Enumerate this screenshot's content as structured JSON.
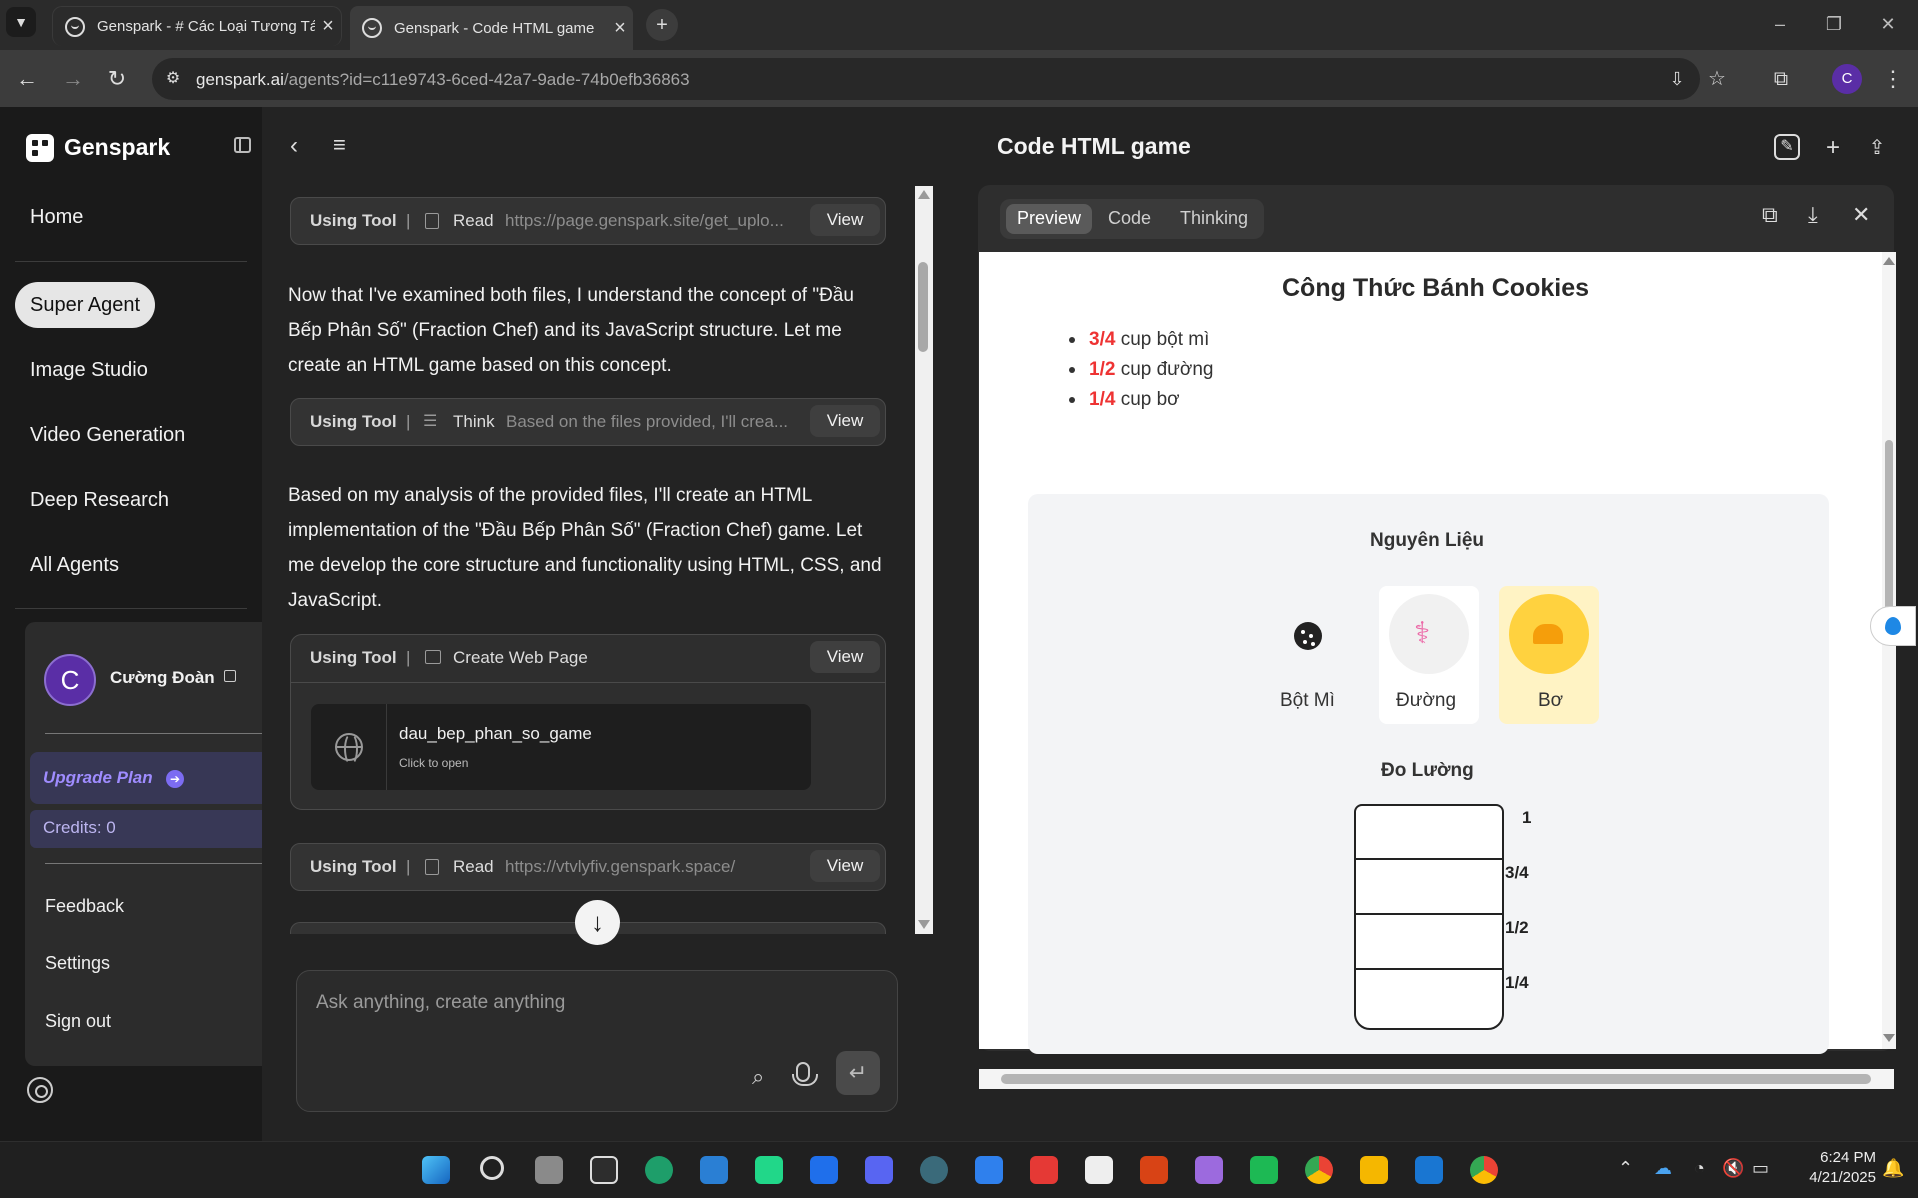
{
  "browser": {
    "tabs": [
      {
        "title": "Genspark - # Các Loại Tương Tá",
        "active": false
      },
      {
        "title": "Genspark - Code HTML game",
        "active": true
      }
    ],
    "url_host": "genspark.ai",
    "url_path": "/agents?id=c11e9743-6ced-42a7-9ade-74b0efb36863"
  },
  "sidebar": {
    "brand": "Genspark",
    "items": [
      {
        "label": "Home"
      },
      {
        "label": "Super Agent",
        "active": true
      },
      {
        "label": "Image Studio"
      },
      {
        "label": "Video Generation"
      },
      {
        "label": "Deep Research"
      },
      {
        "label": "All Agents"
      }
    ]
  },
  "account": {
    "avatar_letter": "C",
    "name": "Cường Đoàn",
    "upgrade_label": "Upgrade Plan",
    "credits_label": "Credits:  0",
    "menu": [
      "Feedback",
      "Settings",
      "Sign out"
    ]
  },
  "chat": {
    "tool_label": "Using Tool",
    "view_label": "View",
    "tools": [
      {
        "name": "Read",
        "arg": "https://page.genspark.site/get_uplo..."
      },
      {
        "name": "Think",
        "arg": "Based on the files provided, I'll crea..."
      },
      {
        "name": "Create Web Page",
        "arg": ""
      },
      {
        "name": "Read",
        "arg": "https://vtvlyfiv.genspark.space/"
      }
    ],
    "messages": [
      "Now that I've examined both files, I understand the concept of \"Đầu Bếp Phân Số\" (Fraction Chef) and its JavaScript structure. Let me create an HTML game based on this concept.",
      "Based on my analysis of the provided files, I'll create an HTML implementation of the \"Đầu Bếp Phân Số\" (Fraction Chef) game. Let me develop the core structure and functionality using HTML, CSS, and JavaScript."
    ],
    "web_file": {
      "name": "dau_bep_phan_so_game",
      "sub": "Click to open"
    },
    "composer_placeholder": "Ask anything, create anything"
  },
  "panel": {
    "title": "Code HTML game",
    "tabs": [
      "Preview",
      "Code",
      "Thinking"
    ],
    "active_tab": "Preview"
  },
  "game": {
    "recipe_title": "Công Thức Bánh Cookies",
    "recipe": [
      {
        "frac": "3/4",
        "text": " cup bột mì"
      },
      {
        "frac": "1/2",
        "text": " cup đường"
      },
      {
        "frac": "1/4",
        "text": " cup bơ"
      }
    ],
    "ingredients_title": "Nguyên Liệu",
    "ingredients": [
      {
        "label": "Bột Mì",
        "icon": "cookie-icon"
      },
      {
        "label": "Đường",
        "icon": "candy-cane-icon"
      },
      {
        "label": "Bơ",
        "icon": "cheese-icon",
        "selected": true
      }
    ],
    "measure_title": "Đo Lường",
    "measure_ticks": [
      "1",
      "3/4",
      "1/2",
      "1/4"
    ]
  },
  "taskbar": {
    "time": "6:24 PM",
    "date": "4/21/2025"
  },
  "colors": {
    "accent_purple": "#7c6cf2",
    "fraction_red": "#e33333",
    "butter_yellow": "#fff3c4"
  }
}
